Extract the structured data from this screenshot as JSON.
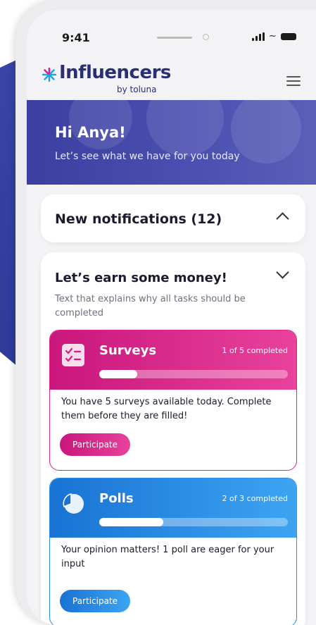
{
  "status": {
    "time": "9:41"
  },
  "header": {
    "brand": "Influencers",
    "brand_sub": "by toluna"
  },
  "banner": {
    "greeting": "Hi Anya!",
    "subtitle": "Let’s see what we have for you today"
  },
  "notifications": {
    "title": "New notifications (12)"
  },
  "earn": {
    "title": "Let’s earn some money!",
    "description": "Text that explains why all tasks should be completed"
  },
  "tasks": [
    {
      "name": "Surveys",
      "progress_text": "1 of 5 completed",
      "progress": 0.2,
      "body": "You have 5 surveys available today. Complete them before they are filled!",
      "button": "Participate",
      "accent": "#e11f86"
    },
    {
      "name": "Polls",
      "progress_text": "2 of 3 completed",
      "progress": 0.34,
      "body": "Your opinion matters! 1 poll are eager for your input",
      "button": "Participate",
      "accent": "#2b8de4"
    }
  ],
  "icons": {
    "menu": "hamburger-icon",
    "collapse": "chevron-up-icon",
    "expand": "chevron-down-icon",
    "surveys": "checklist-icon",
    "polls": "pie-chart-icon"
  }
}
